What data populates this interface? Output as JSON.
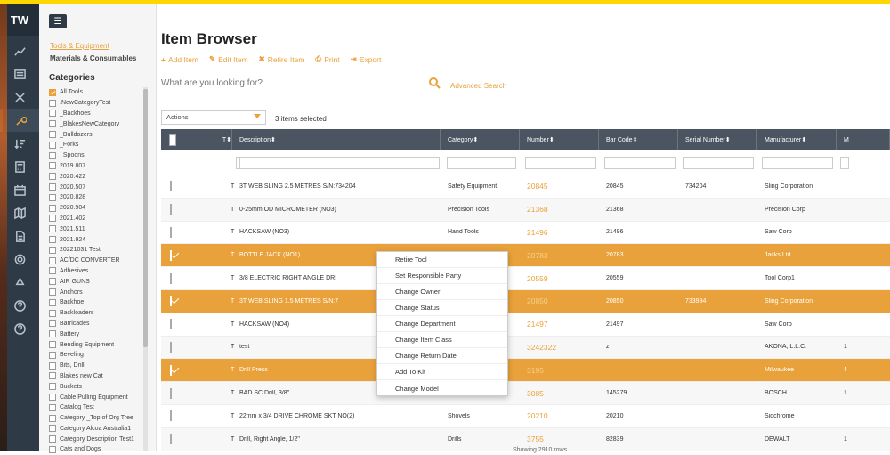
{
  "app": {
    "logo": "TW"
  },
  "sidebar": {
    "menu_icon": "hamburger-icon",
    "links": [
      "Tools & Equipment",
      "Materials & Consumables"
    ],
    "categories_title": "Categories",
    "categories": [
      {
        "label": "All Tools",
        "checked": true
      },
      {
        "label": ".NewCategoryTest",
        "checked": false
      },
      {
        "label": "_Backhoes",
        "checked": false
      },
      {
        "label": "_BlakesNewCategory",
        "checked": false
      },
      {
        "label": "_Bulldozers",
        "checked": false
      },
      {
        "label": "_Forks",
        "checked": false
      },
      {
        "label": "_Spoons",
        "checked": false
      },
      {
        "label": "2019.807",
        "checked": false
      },
      {
        "label": "2020.422",
        "checked": false
      },
      {
        "label": "2020.507",
        "checked": false
      },
      {
        "label": "2020.828",
        "checked": false
      },
      {
        "label": "2020.904",
        "checked": false
      },
      {
        "label": "2021.402",
        "checked": false
      },
      {
        "label": "2021.511",
        "checked": false
      },
      {
        "label": "2021.924",
        "checked": false
      },
      {
        "label": "20221031 Test",
        "checked": false
      },
      {
        "label": "AC/DC CONVERTER",
        "checked": false
      },
      {
        "label": "Adhesives",
        "checked": false
      },
      {
        "label": "AIR GUNS",
        "checked": false
      },
      {
        "label": "Anchors",
        "checked": false
      },
      {
        "label": "Backhoe",
        "checked": false
      },
      {
        "label": "Backloaders",
        "checked": false
      },
      {
        "label": "Barricades",
        "checked": false
      },
      {
        "label": "Battery",
        "checked": false
      },
      {
        "label": "Bending Equipment",
        "checked": false
      },
      {
        "label": "Beveling",
        "checked": false
      },
      {
        "label": "Bits, Drill",
        "checked": false
      },
      {
        "label": "Blakes new Cat",
        "checked": false
      },
      {
        "label": "Buckets",
        "checked": false
      },
      {
        "label": "Cable Pulling Equipment",
        "checked": false
      },
      {
        "label": "Catalog Test",
        "checked": false
      },
      {
        "label": "Category _Top of Org Tree",
        "checked": false
      },
      {
        "label": "Category Alcoa Australia1",
        "checked": false
      },
      {
        "label": "Category Description Test1",
        "checked": false
      },
      {
        "label": "Cats and Dogs",
        "checked": false
      }
    ]
  },
  "main": {
    "title": "Item Browser",
    "toolbar": [
      {
        "label": "Add Item",
        "icon": "plus-icon"
      },
      {
        "label": "Edit Item",
        "icon": "edit-icon"
      },
      {
        "label": "Retire Item",
        "icon": "tools-icon"
      },
      {
        "label": "Print",
        "icon": "print-icon"
      },
      {
        "label": "Export",
        "icon": "export-icon"
      }
    ],
    "search": {
      "placeholder": "What are you looking for?",
      "advanced": "Advanced Search"
    },
    "actions": {
      "label": "Actions",
      "selected_info": "3 items selected"
    },
    "footer": "Showing 2910 rows"
  },
  "table": {
    "columns": [
      "T",
      "Description",
      "Category",
      "Number",
      "Bar Code",
      "Serial Number",
      "Manufacturer",
      "M"
    ],
    "rows": [
      {
        "checked": false,
        "t": "T",
        "desc": "3T WEB SLING 2.5 METRES S/N:734204",
        "cat": "Safety Equipment",
        "num": "20845",
        "bar": "20845",
        "serial": "734204",
        "mfr": "Sling Corporation",
        "extra": ""
      },
      {
        "checked": false,
        "t": "T",
        "desc": "0-25mm OD MICROMETER (NO3)",
        "cat": "Precision Tools",
        "num": "21368",
        "bar": "21368",
        "serial": "",
        "mfr": "Precision Corp",
        "extra": ""
      },
      {
        "checked": false,
        "t": "T",
        "desc": "HACKSAW (NO3)",
        "cat": "Hand Tools",
        "num": "21496",
        "bar": "21496",
        "serial": "",
        "mfr": "Saw Corp",
        "extra": ""
      },
      {
        "checked": true,
        "t": "T",
        "desc": "BOTTLE JACK (NO1)",
        "cat": "Lifting Tools",
        "num": "20783",
        "bar": "20783",
        "serial": "",
        "mfr": "Jacks Ltd",
        "extra": ""
      },
      {
        "checked": false,
        "t": "T",
        "desc": "3/8 ELECTRIC RIGHT ANGLE DRI",
        "cat": "Tools",
        "num": "20559",
        "bar": "20559",
        "serial": "",
        "mfr": "Tool Corp1",
        "extra": ""
      },
      {
        "checked": true,
        "t": "T",
        "desc": "3T WEB SLING 1.5 METRES S/N:7",
        "cat": "Equipment",
        "num": "20850",
        "bar": "20850",
        "serial": "733994",
        "mfr": "Sling Corporation",
        "extra": ""
      },
      {
        "checked": false,
        "t": "T",
        "desc": "HACKSAW (NO4)",
        "cat": "Tools",
        "num": "21497",
        "bar": "21497",
        "serial": "",
        "mfr": "Saw Corp",
        "extra": ""
      },
      {
        "checked": false,
        "t": "T",
        "desc": "test",
        "cat": "dhesives 2",
        "num": "3242322",
        "bar": "z",
        "serial": "",
        "mfr": "AKONA, L.L.C.",
        "extra": "1"
      },
      {
        "checked": true,
        "t": "T",
        "desc": "Drill Press",
        "cat": "resses",
        "num": "3195",
        "bar": "",
        "serial": "",
        "mfr": "Milwaukee",
        "extra": "4"
      },
      {
        "checked": false,
        "t": "T",
        "desc": "BAD SC Drill, 3/8\"",
        "cat": "",
        "num": "3085",
        "bar": "145279",
        "serial": "",
        "mfr": "BOSCH",
        "extra": "1"
      },
      {
        "checked": false,
        "t": "T",
        "desc": "22mm x 3/4 DRIVE CHROME SKT NO(2)",
        "cat": "Shovels",
        "num": "20210",
        "bar": "20210",
        "serial": "",
        "mfr": "Sidchrome",
        "extra": ""
      },
      {
        "checked": false,
        "t": "T",
        "desc": "Drill, Right Angle, 1/2\"",
        "cat": "Drills",
        "num": "3755",
        "bar": "82839",
        "serial": "",
        "mfr": "DEWALT",
        "extra": "1"
      }
    ]
  },
  "context_menu": {
    "items": [
      "Retire Tool",
      "Set Responsible Party",
      "Change Owner",
      "Change Status",
      "Change Department",
      "Change Item Class",
      "Change Return Date",
      "Add To Kit",
      "Change Model"
    ]
  },
  "colors": {
    "accent": "#e9a23b",
    "rail": "#2e3b47",
    "table_header": "#4a5561"
  }
}
